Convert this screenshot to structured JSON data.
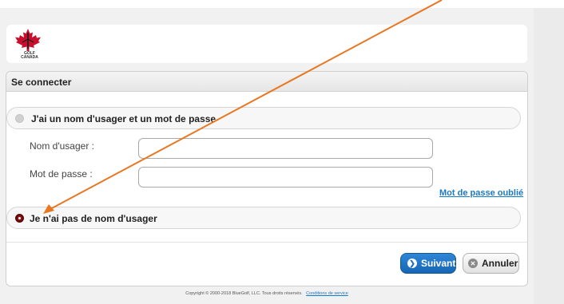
{
  "logo": {
    "line1": "GOLF",
    "line2": "CANADA"
  },
  "panel": {
    "title": "Se connecter"
  },
  "options": {
    "has_account_label": "J'ai un nom d'usager et un mot de passe",
    "no_account_label": "Je n'ai pas de nom d'usager",
    "selected": "no_account"
  },
  "fields": {
    "username_label": "Nom d'usager :",
    "password_label": "Mot de passe :",
    "username_value": "",
    "password_value": ""
  },
  "links": {
    "forgot_password": "Mot de passe oublié"
  },
  "buttons": {
    "next_label": "Suivant",
    "cancel_label": "Annuler"
  },
  "footer": {
    "copyright": "Copyright © 2000-2018 BlueGolf, LLC. Tous droits réservés.",
    "terms_link": "Conditions de service"
  },
  "colors": {
    "accent_blue": "#1a79c6",
    "selected_radio": "#8a1212",
    "annotation_arrow": "#e87722",
    "logo_red": "#c8102e"
  },
  "icons": {
    "next": "chevron-right-circle-icon",
    "cancel": "close-circle-icon",
    "logo": "maple-leaf-logo"
  }
}
